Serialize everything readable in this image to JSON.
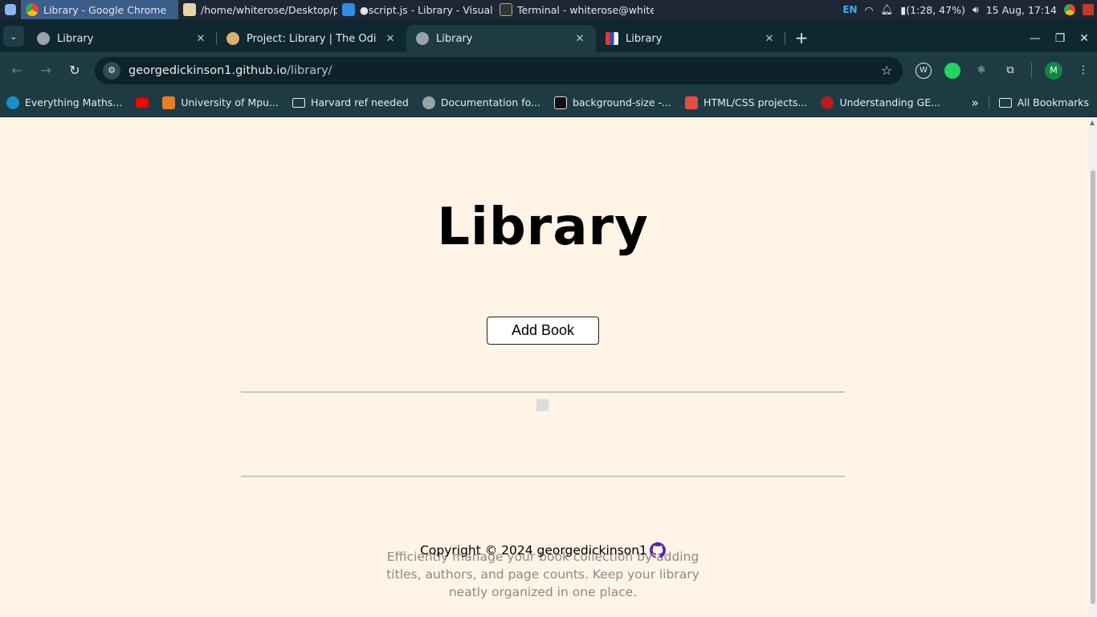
{
  "taskbar": {
    "tasks": [
      {
        "label": "Library - Google Chrome"
      },
      {
        "label": "/home/whiterose/Desktop/p..."
      },
      {
        "label": "●script.js - Library - Visual S..."
      },
      {
        "label": "Terminal - whiterose@white..."
      }
    ],
    "lang": "EN",
    "battery": "(1:28, 47%)",
    "datetime": "15 Aug, 17:14"
  },
  "tabs": [
    {
      "title": "Library",
      "close": "✕"
    },
    {
      "title": "Project: Library | The Odin Pro",
      "close": "✕"
    },
    {
      "title": "Library",
      "close": "✕"
    },
    {
      "title": "Library",
      "close": "✕"
    }
  ],
  "toolbar": {
    "url_host": "georgedickinson1.github.io",
    "url_path": "/library/",
    "profile_initial": "M"
  },
  "bookmarks": {
    "items": [
      {
        "label": "Everything Maths..."
      },
      {
        "label": ""
      },
      {
        "label": "University of Mpu..."
      },
      {
        "label": "Harvard ref needed"
      },
      {
        "label": "Documentation fo..."
      },
      {
        "label": "background-size -..."
      },
      {
        "label": "HTML/CSS projects..."
      },
      {
        "label": "Understanding GE..."
      }
    ],
    "all_label": "All Bookmarks"
  },
  "page": {
    "title": "Library",
    "add_button": "Add Book",
    "description": "Efficiently manage your book collection by adding titles, authors, and page counts. Keep your library neatly organized in one place.",
    "copyright": "Copyright © 2024 georgedickinson1"
  },
  "colors": {
    "page_bg": "#fff4e5",
    "chrome_frame": "#0e2730",
    "chrome_toolbar": "#1e3b44",
    "github_icon": "#5b21b6"
  }
}
